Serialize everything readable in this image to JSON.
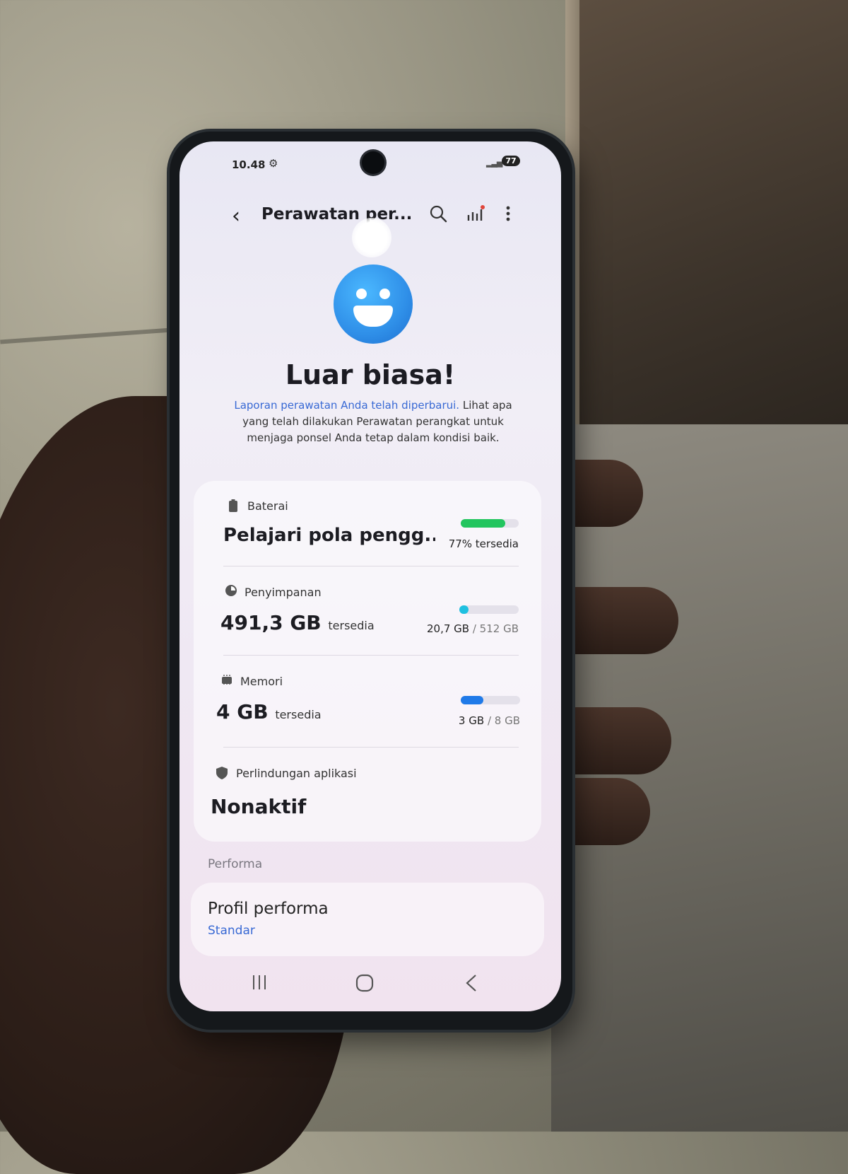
{
  "status_bar": {
    "time": "10.48",
    "battery_level": "77"
  },
  "app_bar": {
    "title": "Perawatan per...",
    "icons": [
      "back-icon",
      "search-icon",
      "report-chart-icon",
      "more-icon"
    ]
  },
  "summary": {
    "icon": "smiley-face-icon",
    "headline": "Luar biasa!",
    "link_text": "Laporan perawatan Anda telah diperbarui.",
    "description": " Lihat apa yang telah dilakukan Perawatan perangkat untuk menjaga ponsel Anda tetap dalam kondisi baik."
  },
  "battery": {
    "label": "Baterai",
    "value": "Pelajari pola pengg...",
    "status": "77% tersedia",
    "level": 0.77,
    "color": "#22c55e"
  },
  "storage": {
    "label": "Penyimpanan",
    "value": "491,3 GB",
    "value_suffix": "tersedia",
    "used": "20,7 GB",
    "total": "/ 512 GB",
    "level": 0.04,
    "color": "#1fc0e0"
  },
  "memory": {
    "label": "Memori",
    "value": "4 GB",
    "value_suffix": "tersedia",
    "used": "3 GB",
    "total": "/ 8 GB",
    "level": 0.375,
    "color": "#1f7ae8"
  },
  "app_protection": {
    "label": "Perlindungan aplikasi",
    "value": "Nonaktif"
  },
  "performance": {
    "section_title": "Performa",
    "profile_title": "Profil performa",
    "profile_value": "Standar"
  },
  "nav_bar": {
    "buttons": [
      "recent-apps-icon",
      "home-icon",
      "back-icon"
    ]
  }
}
